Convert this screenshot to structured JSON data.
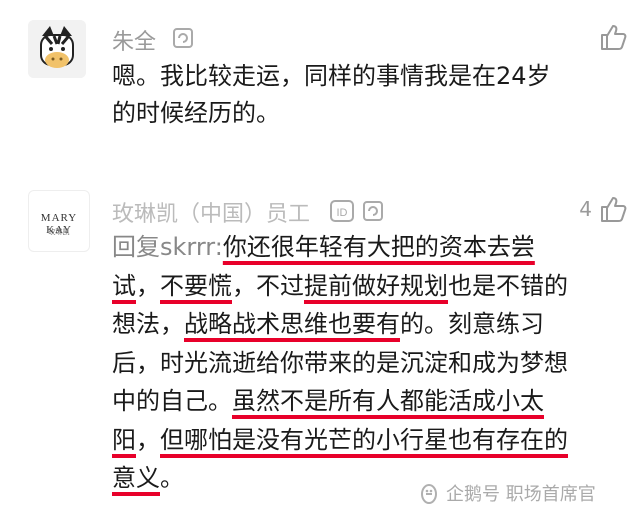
{
  "comments": [
    {
      "username": "朱全",
      "likes": "",
      "text": "嗯。我比较走运，同样的事情我是在24岁的时候经历的。"
    },
    {
      "username": "玫琳凯（中国）员工",
      "avatar_text": "MARY KAY",
      "avatar_subtext": "玫琳凯",
      "likes": "4",
      "reply_prefix": "回复skrrr:",
      "segments": [
        {
          "text": "你还很年轻有大把的资本去尝试",
          "underline": true
        },
        {
          "text": "，",
          "underline": false
        },
        {
          "text": "不要慌",
          "underline": true
        },
        {
          "text": "，不过",
          "underline": false
        },
        {
          "text": "提前做好规划",
          "underline": true
        },
        {
          "text": "也是不错的想法，",
          "underline": false
        },
        {
          "text": "战略战术思维也要有",
          "underline": true
        },
        {
          "text": "的。刻意练习后，时光流逝给你带来的是沉淀和成为梦想中的自己。",
          "underline": false
        },
        {
          "text": "虽然不是所有人都能活成小太阳",
          "underline": true
        },
        {
          "text": "，",
          "underline": false
        },
        {
          "text": "但哪怕是没有光芒的小行星也有存在的意义",
          "underline": true
        },
        {
          "text": "。",
          "underline": false
        }
      ]
    }
  ],
  "watermark": "企鹅号 职场首席官",
  "colors": {
    "accent_underline": "#e8002a",
    "meta_text": "#9a9a9a"
  },
  "icons": [
    "zebra-avatar",
    "thumbs-up-icon",
    "id-badge-icon",
    "reply-icon",
    "penguin-logo-icon"
  ]
}
